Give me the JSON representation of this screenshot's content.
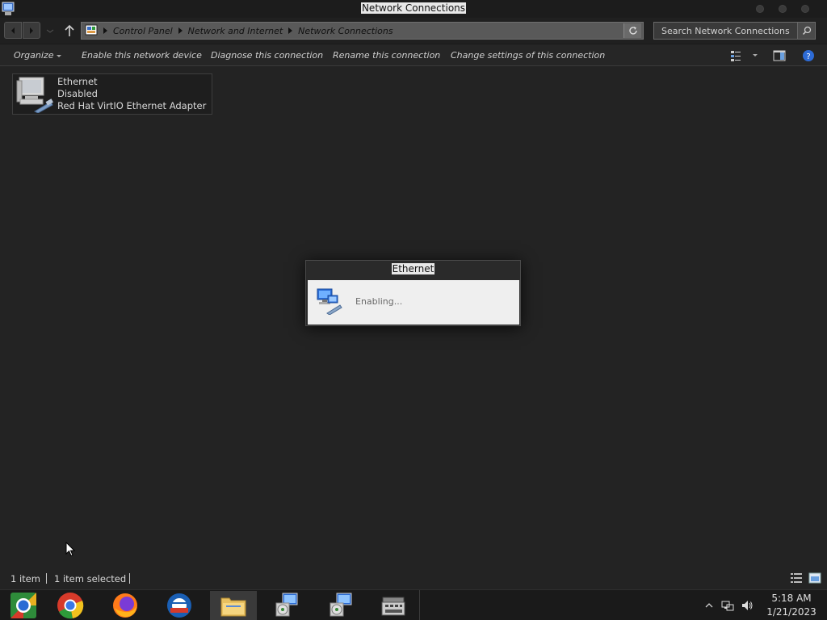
{
  "window": {
    "title": "Network Connections"
  },
  "address": {
    "breadcrumbs": [
      "Control Panel",
      "Network and Internet",
      "Network Connections"
    ]
  },
  "search": {
    "placeholder": "Search Network Connections"
  },
  "commands": {
    "organize": "Organize",
    "enable": "Enable this network device",
    "diagnose": "Diagnose this connection",
    "rename": "Rename this connection",
    "change_settings": "Change settings of this connection"
  },
  "connection": {
    "name": "Ethernet",
    "status": "Disabled",
    "adapter": "Red Hat VirtIO Ethernet Adapter"
  },
  "dialog": {
    "title": "Ethernet",
    "message": "Enabling..."
  },
  "status": {
    "count": "1 item",
    "selection": "1 item selected"
  },
  "taskbar": {
    "items": [
      "chromium-icon",
      "chrome-icon",
      "firefox-icon",
      "outlook-icon",
      "file-explorer-icon",
      "network-installer-icon",
      "network-installer-icon",
      "cash-register-icon"
    ],
    "active": "file-explorer-icon"
  },
  "clock": {
    "time": "5:18 AM",
    "date": "1/21/2023"
  },
  "colors": {
    "background": "#232323",
    "titlebar": "#1c1c1c",
    "address_bar": "#595959",
    "dialog_body": "#efefef",
    "taskbar": "#1a1a1a"
  }
}
